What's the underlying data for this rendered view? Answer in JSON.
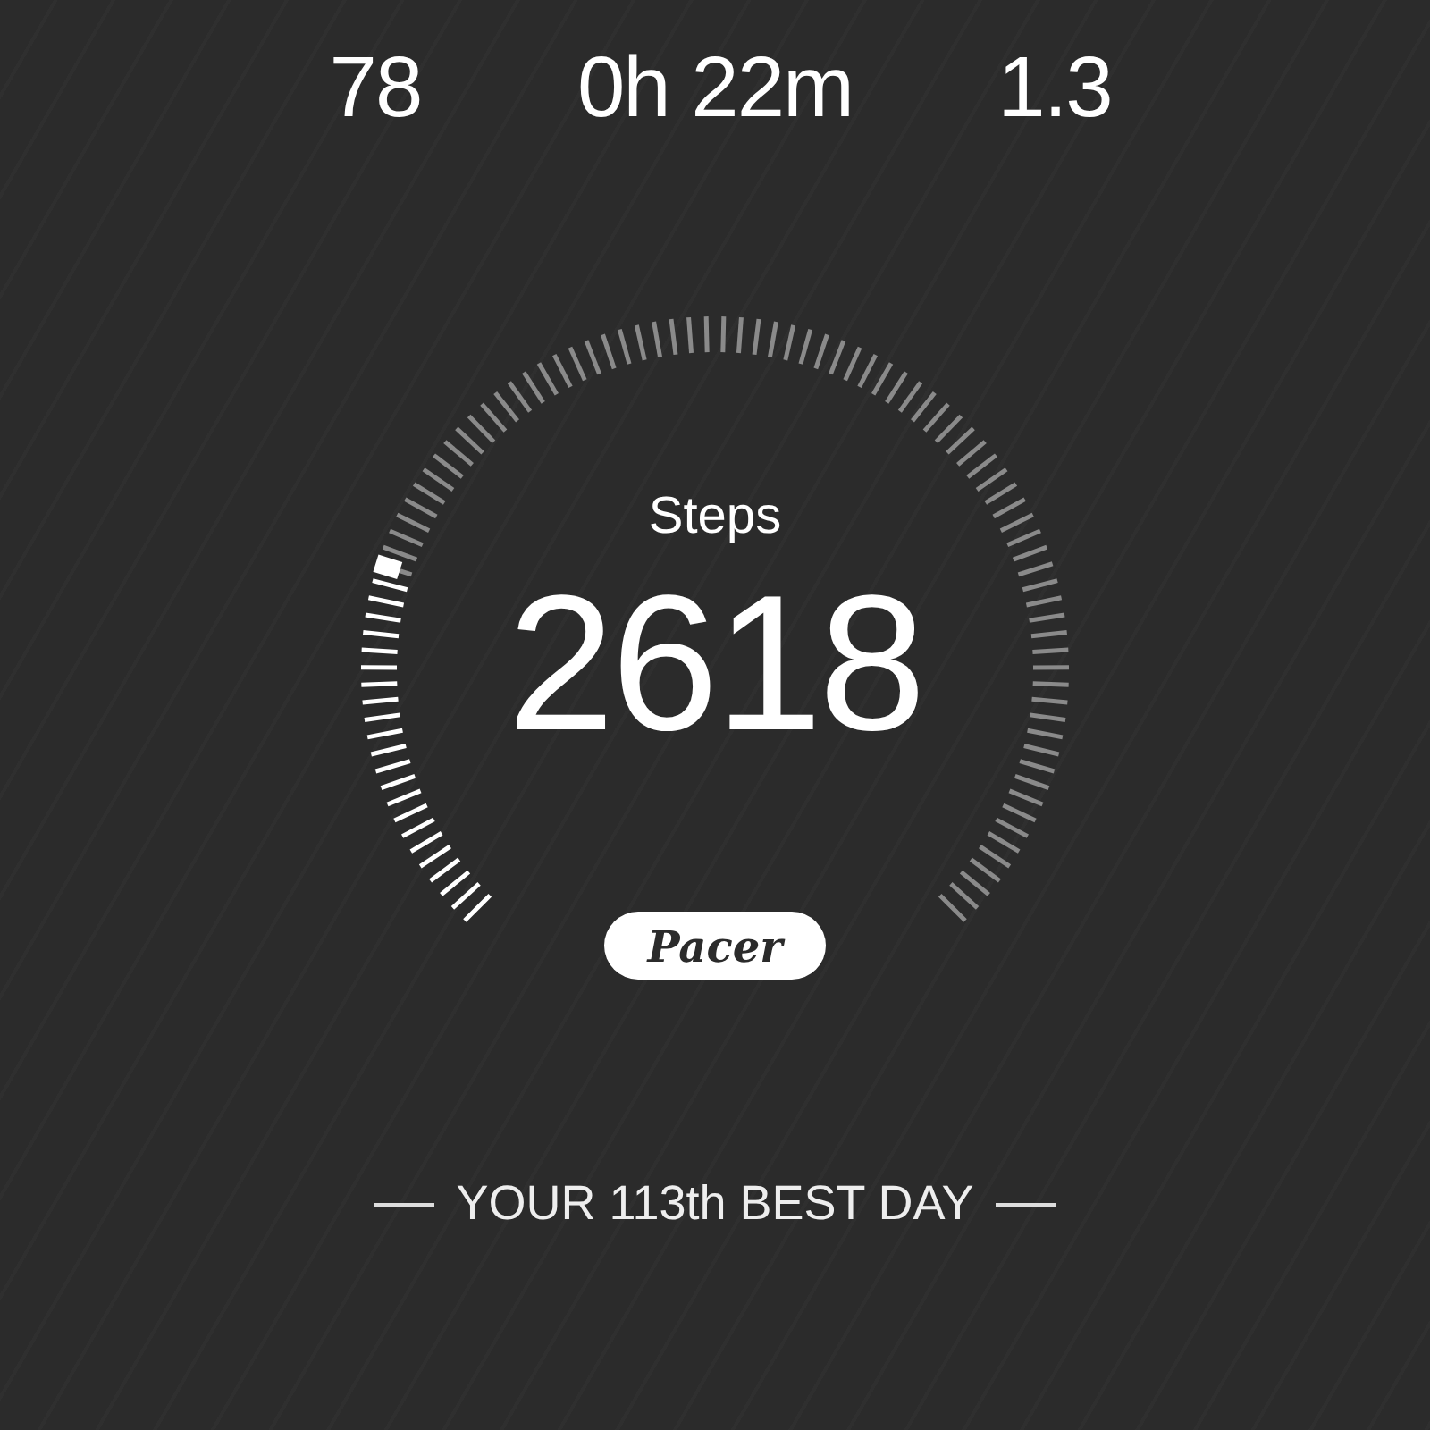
{
  "stats": [
    {
      "value": "78"
    },
    {
      "value": "0h 22m"
    },
    {
      "value": "1.3"
    }
  ],
  "gauge": {
    "label": "Steps",
    "value": "2618"
  },
  "brand": "Pacer",
  "rank": {
    "text": "YOUR 113th BEST DAY"
  }
}
